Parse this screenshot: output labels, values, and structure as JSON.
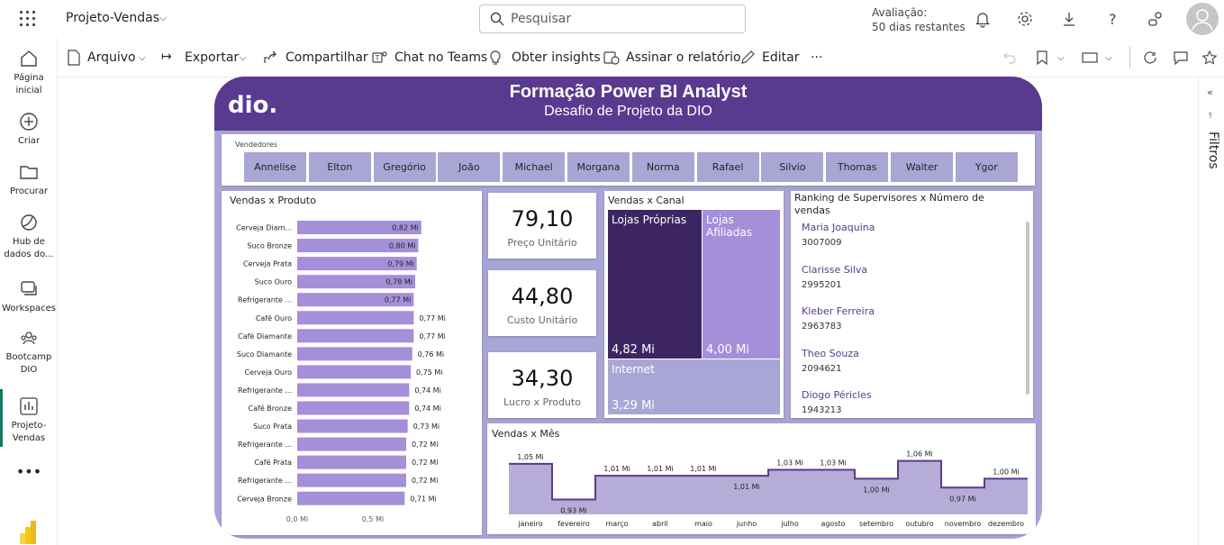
{
  "topbar": {
    "workspace": "Projeto-Vendas",
    "search_placeholder": "Pesquisar",
    "trial_line1": "Avaliação:",
    "trial_line2": "50 dias restantes"
  },
  "nav": [
    {
      "label": "Página inicial",
      "icon": "home-icon"
    },
    {
      "label": "Criar",
      "icon": "create-icon"
    },
    {
      "label": "Procurar",
      "icon": "browse-icon"
    },
    {
      "label": "Hub de dados do...",
      "icon": "datahub-icon"
    },
    {
      "label": "Workspaces",
      "icon": "workspaces-icon"
    },
    {
      "label": "Bootcamp DIO",
      "icon": "workspace-icon"
    },
    {
      "label": "Projeto-Vendas",
      "icon": "report-icon"
    }
  ],
  "ribbon": {
    "arquivo": "Arquivo",
    "exportar": "Exportar",
    "compartilhar": "Compartilhar",
    "chat": "Chat no Teams",
    "insights": "Obter insights",
    "assinar": "Assinar o relatório",
    "editar": "Editar",
    "more": "..."
  },
  "filters_label": "Filtros",
  "report": {
    "title": "Formação Power BI Analyst",
    "subtitle": "Desafio de Projeto da DIO",
    "logo": "dio.",
    "slicer": {
      "label": "Vendedores",
      "items": [
        "Annelise",
        "Elton",
        "Gregório",
        "João",
        "Michael",
        "Morgana",
        "Norma",
        "Rafael",
        "Silvio",
        "Thomas",
        "Walter",
        "Ygor"
      ]
    },
    "kpis": [
      {
        "value": "79,10",
        "label": "Preço Unitário"
      },
      {
        "value": "44,80",
        "label": "Custo Unitário"
      },
      {
        "value": "34,30",
        "label": "Lucro x Produto"
      }
    ],
    "treemap": {
      "title": "Vendas x Canal",
      "items": [
        {
          "name": "Lojas Próprias",
          "value": "4,82 Mi",
          "color": "#3d2563"
        },
        {
          "name": "Lojas Afiliadas",
          "value": "4,00 Mi",
          "color": "#a48fd8"
        },
        {
          "name": "Internet",
          "value": "3,29 Mi",
          "color": "#a9a6d6"
        }
      ]
    },
    "ranking": {
      "title": "Ranking de Supervisores x Número de vendas",
      "items": [
        {
          "name": "Maria Joaquina",
          "value": "3007009"
        },
        {
          "name": "Clarisse Silva",
          "value": "2995201"
        },
        {
          "name": "Kleber Ferreira",
          "value": "2963783"
        },
        {
          "name": "Theo Souza",
          "value": "2094621"
        },
        {
          "name": "Diogo Péricles",
          "value": "1943213"
        }
      ]
    }
  },
  "chart_data": [
    {
      "type": "bar",
      "title": "Vendas x Produto",
      "orientation": "horizontal",
      "categories": [
        "Cerveja Diam...",
        "Suco Bronze",
        "Cerveja Prata",
        "Suco Ouro",
        "Refrigerante ...",
        "Café Ouro",
        "Café Diamante",
        "Suco Diamante",
        "Cerveja Ouro",
        "Refrigerante ...",
        "Café Bronze",
        "Suco Prata",
        "Refrigerante ...",
        "Café Prata",
        "Refrigerante ...",
        "Cerveja Bronze"
      ],
      "values": [
        0.82,
        0.8,
        0.79,
        0.78,
        0.77,
        0.77,
        0.77,
        0.76,
        0.75,
        0.74,
        0.74,
        0.73,
        0.72,
        0.72,
        0.72,
        0.71
      ],
      "value_labels": [
        "0,82 Mi",
        "0,80 Mi",
        "0,79 Mi",
        "0,78 Mi",
        "0,77 Mi",
        "0,77 Mi",
        "0,77 Mi",
        "0,76 Mi",
        "0,75 Mi",
        "0,74 Mi",
        "0,74 Mi",
        "0,73 Mi",
        "0,72 Mi",
        "0,72 Mi",
        "0,72 Mi",
        "0,71 Mi"
      ],
      "xticks": [
        "0,0 Mi",
        "0,5 Mi"
      ],
      "xlim": [
        0,
        1
      ],
      "color": "#a48fd8"
    },
    {
      "type": "area",
      "title": "Vendas x Mês",
      "step": true,
      "categories": [
        "janeiro",
        "fevereiro",
        "março",
        "abril",
        "maio",
        "junho",
        "julho",
        "agosto",
        "setembro",
        "outubro",
        "novembro",
        "dezembro"
      ],
      "values": [
        1.05,
        0.93,
        1.01,
        1.01,
        1.01,
        1.01,
        1.03,
        1.03,
        1.0,
        1.06,
        0.97,
        1.0
      ],
      "value_labels": [
        "1,05 Mi",
        "0,93 Mi",
        "1,01 Mi",
        "1,01 Mi",
        "1,01 Mi",
        "1,01 Mi",
        "1,03 Mi",
        "1,03 Mi",
        "1,00 Mi",
        "1,06 Mi",
        "0,97 Mi",
        "1,00 Mi"
      ],
      "ylim": [
        0.88,
        1.08
      ],
      "color": "#b6acd8",
      "line_color": "#5a3a8f"
    }
  ]
}
